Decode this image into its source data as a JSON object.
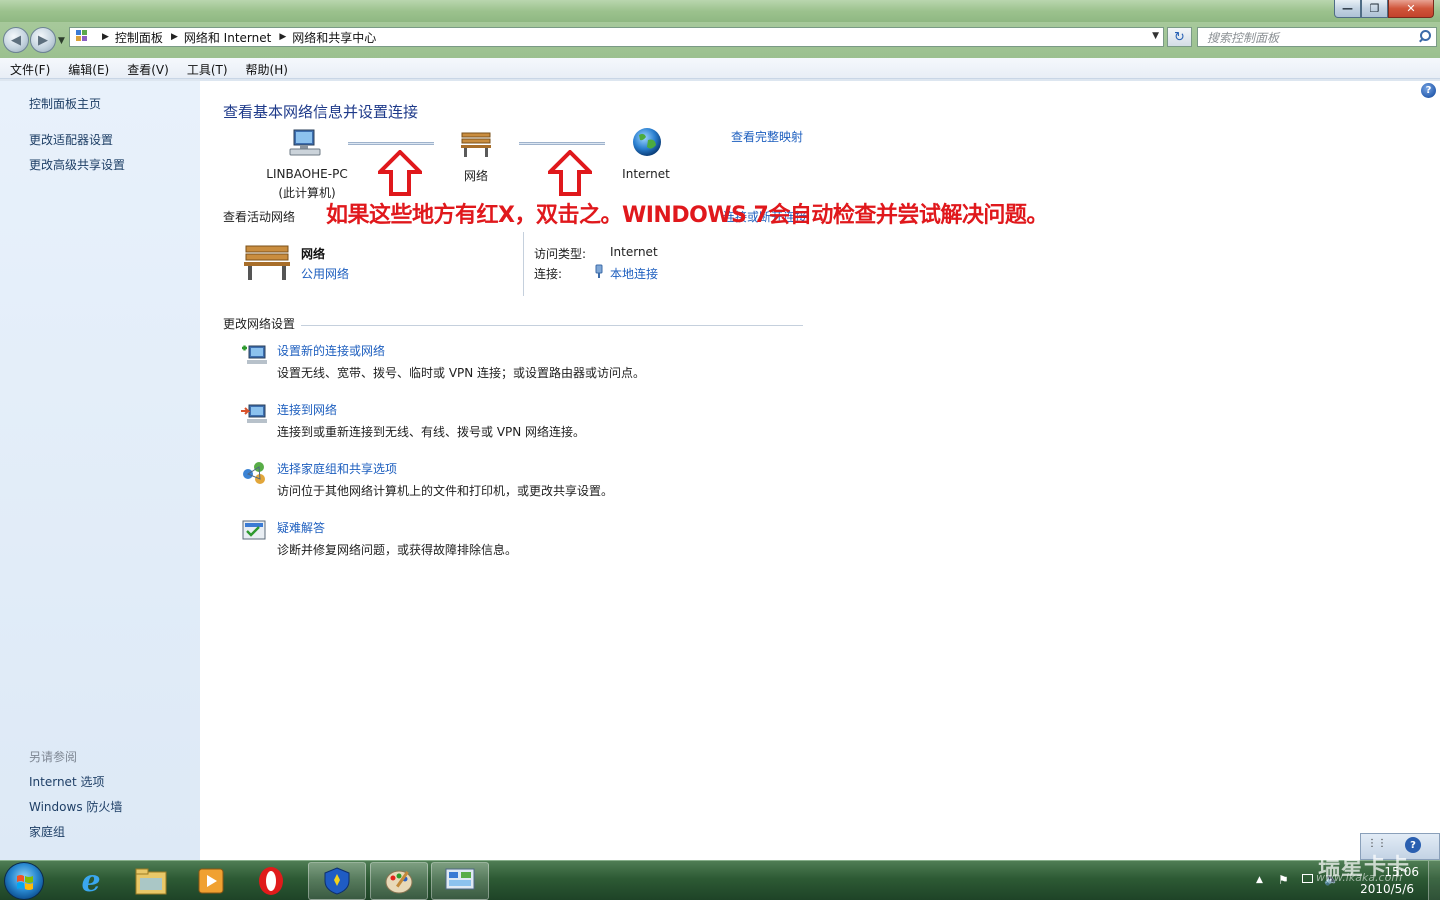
{
  "window": {
    "buttons": {
      "minimize": "—",
      "maximize": "❐",
      "close": "✕"
    }
  },
  "navigation": {
    "back_icon": "back-arrow-icon",
    "forward_icon": "forward-arrow-icon",
    "breadcrumb": [
      "控制面板",
      "网络和 Internet",
      "网络和共享中心"
    ],
    "search_placeholder": "搜索控制面板"
  },
  "menu": [
    "文件(F)",
    "编辑(E)",
    "查看(V)",
    "工具(T)",
    "帮助(H)"
  ],
  "sidebar": {
    "links": [
      "控制面板主页",
      "更改适配器设置",
      "更改高级共享设置"
    ],
    "see_also_title": "另请参阅",
    "see_also": [
      "Internet 选项",
      "Windows 防火墙",
      "家庭组"
    ]
  },
  "main": {
    "title": "查看基本网络信息并设置连接",
    "map": {
      "computer_name": "LINBAOHE-PC",
      "computer_note": "(此计算机)",
      "network": "网络",
      "internet": "Internet",
      "full_map_link": "查看完整映射"
    },
    "active_networks": {
      "section_title": "查看活动网络",
      "hidden_link": "连接或断开连接",
      "network_name": "网络",
      "network_type": "公用网络",
      "access_type_label": "访问类型:",
      "access_type_value": "Internet",
      "connection_label": "连接:",
      "connection_value": "本地连接"
    },
    "change_settings": {
      "section_title": "更改网络设置",
      "tasks": [
        {
          "link": "设置新的连接或网络",
          "desc": "设置无线、宽带、拨号、临时或 VPN 连接；或设置路由器或访问点。"
        },
        {
          "link": "连接到网络",
          "desc": "连接到或重新连接到无线、有线、拨号或 VPN 网络连接。"
        },
        {
          "link": "选择家庭组和共享选项",
          "desc": "访问位于其他网络计算机上的文件和打印机，或更改共享设置。"
        },
        {
          "link": "疑难解答",
          "desc": "诊断并修复网络问题，或获得故障排除信息。"
        }
      ]
    },
    "annotation": "如果这些地方有红X，双击之。WINDOWS 7会自动检查并尝试解决问题。"
  },
  "taskbar": {
    "apps": [
      "internet-explorer-icon",
      "explorer-folder-icon",
      "media-player-icon",
      "opera-icon",
      "shield-app-icon",
      "paint-icon",
      "network-center-icon"
    ],
    "clock_time": "15:06",
    "clock_date": "2010/5/6",
    "watermark": "瑞星卡卡",
    "watermark_url": "www.ikaka.com"
  },
  "colors": {
    "accent_link": "#1e5fbf",
    "annotation_red": "#e0181c",
    "sidebar_bg": "#e3edf9",
    "taskbar": "#2d5a34"
  }
}
